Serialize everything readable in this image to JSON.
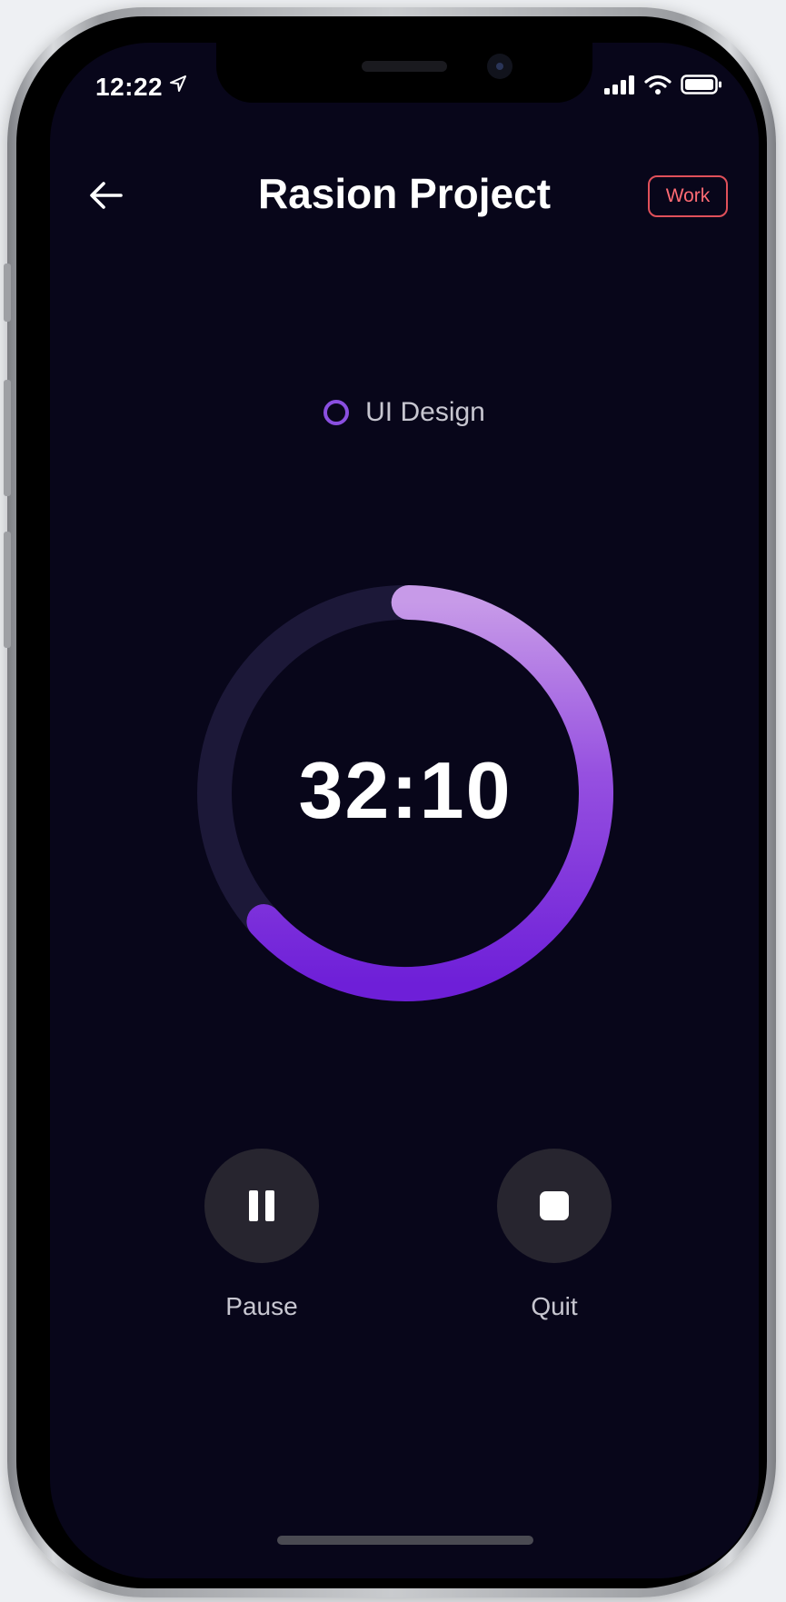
{
  "status_bar": {
    "time": "12:22"
  },
  "header": {
    "title": "Rasion Project",
    "tag": "Work"
  },
  "task": {
    "label": "UI Design"
  },
  "timer": {
    "display": "32:10",
    "progress_fraction": 0.63
  },
  "controls": {
    "pause_label": "Pause",
    "quit_label": "Quit"
  },
  "colors": {
    "background": "#08061a",
    "accent": "#8a4fe0",
    "tag_red": "#e0505a",
    "button_bg": "#27252f"
  }
}
